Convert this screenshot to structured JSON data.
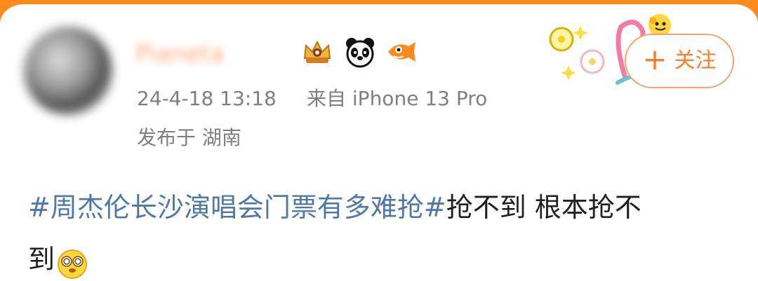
{
  "user": {
    "name": "Pianeta",
    "badges": [
      {
        "icon": "crown-badge-icon",
        "color": "#f0b13f"
      },
      {
        "icon": "panda-badge-icon",
        "color": "#111111"
      },
      {
        "icon": "fish-badge-icon",
        "color": "#ff8a1c"
      }
    ]
  },
  "meta": {
    "time": "24-4-18 13:18",
    "source": "来自 iPhone 13 Pro",
    "location": "发布于 湖南"
  },
  "follow_button": {
    "plus": "+",
    "label": "关注"
  },
  "post": {
    "topic": "#周杰伦长沙演唱会门票有多难抢#",
    "text_line1": "抢不到 根本抢不",
    "text_line2": "到",
    "emoji": "dazed-face-emoji-icon"
  },
  "colors": {
    "accent": "#ff8a1c",
    "topic": "#4f78a6",
    "meta": "#7f7f7f"
  }
}
